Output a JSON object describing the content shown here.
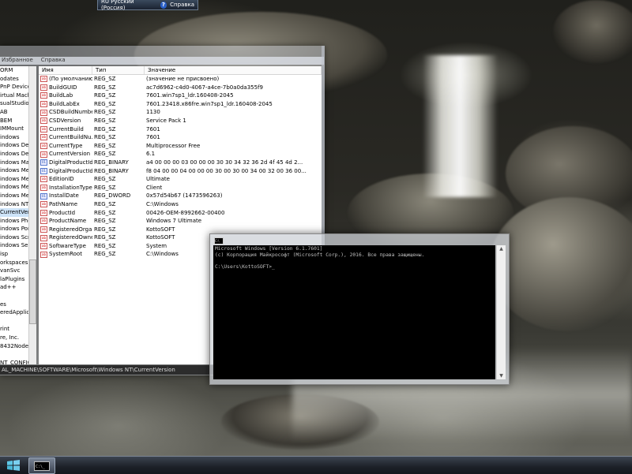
{
  "language_bar": {
    "language": "RU Русский (Россия)",
    "help": "Справка"
  },
  "regedit": {
    "menu": [
      "Избранное",
      "Справка"
    ],
    "tree_items": [
      "ORM",
      "odates",
      "PnP Device I",
      "irtual Machin",
      "sualStudio",
      "AB",
      "BEM",
      "IMMount",
      "indows",
      "indows Defe",
      "indows Desk",
      "indows Mail",
      "indows Med",
      "indows Med",
      "indows Med",
      "indows Mes:",
      "indows NT",
      "CurrentVer",
      "indows Phot",
      "indows Port",
      "indows Scrip",
      "indows Sear",
      "isp",
      "orkspaces",
      "vanSvc",
      "laPlugins",
      "ad++",
      "",
      "es",
      "eredApplica",
      "",
      "rint",
      "re, Inc.",
      "8432Node",
      "",
      "NT_CONFIG"
    ],
    "selected_tree_index": 17,
    "columns": {
      "name": "Имя",
      "type": "Тип",
      "data": "Значение"
    },
    "rows": [
      {
        "name": "(По умолчанию)",
        "type": "REG_SZ",
        "data": "(значение не присвоено)",
        "kind": "sz"
      },
      {
        "name": "BuildGUID",
        "type": "REG_SZ",
        "data": "ac7d6962-c4d0-4067-a4ce-7b0a0da355f9",
        "kind": "sz"
      },
      {
        "name": "BuildLab",
        "type": "REG_SZ",
        "data": "7601.win7sp1_ldr.160408-2045",
        "kind": "sz"
      },
      {
        "name": "BuildLabEx",
        "type": "REG_SZ",
        "data": "7601.23418.x86fre.win7sp1_ldr.160408-2045",
        "kind": "sz"
      },
      {
        "name": "CSDBuildNumber",
        "type": "REG_SZ",
        "data": "1130",
        "kind": "sz"
      },
      {
        "name": "CSDVersion",
        "type": "REG_SZ",
        "data": "Service Pack 1",
        "kind": "sz"
      },
      {
        "name": "CurrentBuild",
        "type": "REG_SZ",
        "data": "7601",
        "kind": "sz"
      },
      {
        "name": "CurrentBuildNu...",
        "type": "REG_SZ",
        "data": "7601",
        "kind": "sz"
      },
      {
        "name": "CurrentType",
        "type": "REG_SZ",
        "data": "Multiprocessor Free",
        "kind": "sz"
      },
      {
        "name": "CurrentVersion",
        "type": "REG_SZ",
        "data": "6.1",
        "kind": "sz"
      },
      {
        "name": "DigitalProductId",
        "type": "REG_BINARY",
        "data": "a4 00 00 00 03 00 00 00 30 30 34 32 36 2d 4f 45 4d 2...",
        "kind": "bin"
      },
      {
        "name": "DigitalProductId4",
        "type": "REG_BINARY",
        "data": "f8 04 00 00 04 00 00 00 30 00 30 00 34 00 32 00 36 00...",
        "kind": "bin"
      },
      {
        "name": "EditionID",
        "type": "REG_SZ",
        "data": "Ultimate",
        "kind": "sz"
      },
      {
        "name": "InstallationType",
        "type": "REG_SZ",
        "data": "Client",
        "kind": "sz"
      },
      {
        "name": "InstallDate",
        "type": "REG_DWORD",
        "data": "0x57d54b67 (1473596263)",
        "kind": "bin"
      },
      {
        "name": "PathName",
        "type": "REG_SZ",
        "data": "C:\\Windows",
        "kind": "sz"
      },
      {
        "name": "ProductId",
        "type": "REG_SZ",
        "data": "00426-OEM-8992662-00400",
        "kind": "sz"
      },
      {
        "name": "ProductName",
        "type": "REG_SZ",
        "data": "Windows 7 Ultimate",
        "kind": "sz"
      },
      {
        "name": "RegisteredOrga...",
        "type": "REG_SZ",
        "data": "KottoSOFT",
        "kind": "sz"
      },
      {
        "name": "RegisteredOwner",
        "type": "REG_SZ",
        "data": "KottoSOFT",
        "kind": "sz"
      },
      {
        "name": "SoftwareType",
        "type": "REG_SZ",
        "data": "System",
        "kind": "sz"
      },
      {
        "name": "SystemRoot",
        "type": "REG_SZ",
        "data": "C:\\Windows",
        "kind": "sz"
      }
    ],
    "status_path": "AL_MACHINE\\SOFTWARE\\Microsoft\\Windows NT\\CurrentVersion"
  },
  "cmd": {
    "title_icon": "C:\\",
    "lines": [
      "Microsoft Windows [Version 6.1.7601]",
      "(c) Корпорация Майкрософт (Microsoft Corp.), 2016. Все права защищены.",
      "",
      "C:\\Users\\KottoSOFT>_"
    ]
  },
  "taskbar": {
    "task_icon_label": "C:\\_"
  },
  "colors": {
    "taskbar": "#1c2028",
    "cmd_bg": "#000000",
    "cmd_text": "#c0c0c0",
    "selection": "#cde3f8"
  }
}
